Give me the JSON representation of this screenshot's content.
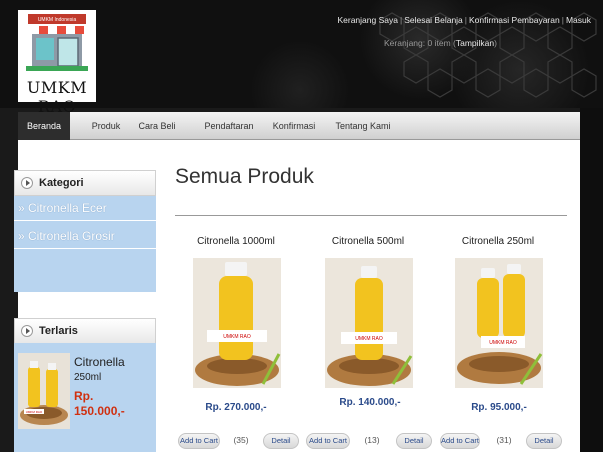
{
  "header": {
    "logo": {
      "badge_text": "UMKM Indonesia",
      "text": "UMKM RAO"
    },
    "top_links": [
      "Keranjang Saya",
      "Selesai Belanja",
      "Konfirmasi Pembayaran",
      "Masuk"
    ],
    "cart": {
      "prefix": "Keranjang:",
      "count": "0 item",
      "open_paren": "(",
      "show": "Tampilkan",
      "close_paren": ")"
    }
  },
  "nav": {
    "items": [
      {
        "label": "Beranda",
        "active": true
      },
      {
        "label": "Produk",
        "active": false
      },
      {
        "label": "Cara Beli",
        "active": false
      },
      {
        "label": "Pendaftaran",
        "active": false
      },
      {
        "label": "Konfirmasi",
        "active": false
      },
      {
        "label": "Tentang Kami",
        "active": false
      }
    ]
  },
  "sidebar": {
    "categories_title": "Kategori",
    "categories": [
      "» Citronella Ecer",
      "» Citronella Grosir"
    ],
    "bestseller_title": "Terlaris",
    "bestseller": {
      "name_line1": "Citronella",
      "name_line2": "250ml",
      "price_line1": "Rp.",
      "price_line2": "150.000,-"
    }
  },
  "main": {
    "title": "Semua Produk",
    "products": [
      {
        "name": "Citronella 1000ml",
        "price": "Rp. 270.000,-",
        "add_label": "Add to Cart",
        "count": "(35)",
        "detail_label": "Detail",
        "label_text": "UMKM RAO"
      },
      {
        "name": "Citronella 500ml",
        "price": "Rp. 140.000,-",
        "add_label": "Add to Cart",
        "count": "(13)",
        "detail_label": "Detail",
        "label_text": "UMKM RAO"
      },
      {
        "name": "Citronella 250ml",
        "price": "Rp. 95.000,-",
        "add_label": "Add to Cart",
        "count": "(31)",
        "detail_label": "Detail",
        "label_text": "UMKM RAO"
      }
    ]
  },
  "colors": {
    "accent_blue": "#b8d4ef",
    "price_red": "#d03010",
    "price_blue": "#2a4a8a",
    "nav_active": "#2d2d2d"
  }
}
